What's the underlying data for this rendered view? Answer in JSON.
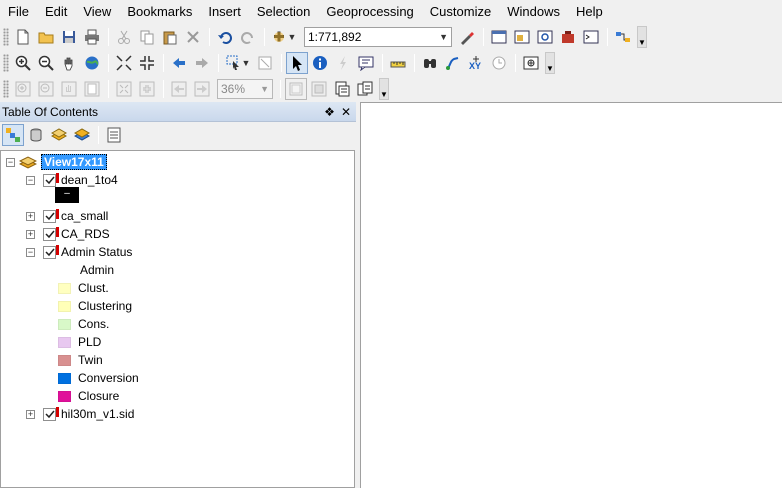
{
  "menubar": [
    "File",
    "Edit",
    "View",
    "Bookmarks",
    "Insert",
    "Selection",
    "Geoprocessing",
    "Customize",
    "Windows",
    "Help"
  ],
  "standard_toolbar": {
    "scale": "1:771,892"
  },
  "layout_toolbar": {
    "zoom": "36%"
  },
  "toc": {
    "title": "Table Of Contents",
    "pin": "❖",
    "close": "✕",
    "frame": "View17x11",
    "layers": {
      "dean": "dean_1to4",
      "dean_sym": "–",
      "ca_small": "ca_small",
      "ca_rds": "CA_RDS",
      "admin": "Admin Status",
      "admin_field": "Admin",
      "hil": "hil30m_v1.sid"
    },
    "classes": [
      {
        "label": "Clust.",
        "color": "#ffffc0"
      },
      {
        "label": "Clustering",
        "color": "#ffffb8"
      },
      {
        "label": "Cons.",
        "color": "#d8f8c8"
      },
      {
        "label": "PLD",
        "color": "#e8c8f0"
      },
      {
        "label": "Twin",
        "color": "#d89090"
      },
      {
        "label": "Conversion",
        "color": "#0070e0"
      },
      {
        "label": "Closure",
        "color": "#e0109a"
      }
    ]
  }
}
